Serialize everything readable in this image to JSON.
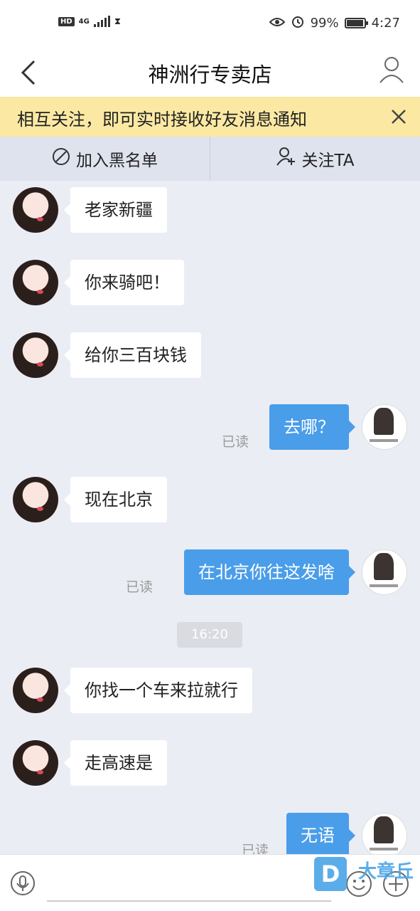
{
  "status_bar": {
    "hd": "HD",
    "network": "4G",
    "battery": "99%",
    "battery_level": 0.99,
    "time": "4:27"
  },
  "nav": {
    "title": "神洲行专卖店"
  },
  "banner": {
    "text": "相互关注，即可实时接收好友消息通知"
  },
  "actions": {
    "blacklist": "加入黑名单",
    "follow": "关注TA"
  },
  "messages": [
    {
      "side": "in",
      "text": "老家新疆"
    },
    {
      "side": "in",
      "text": "你来骑吧！"
    },
    {
      "side": "in",
      "text": "给你三百块钱"
    },
    {
      "side": "out",
      "text": "去哪？",
      "status": "已读"
    },
    {
      "side": "in",
      "text": "现在北京"
    },
    {
      "side": "out",
      "text": "在北京你往这发啥",
      "status": "已读"
    },
    {
      "side": "time",
      "text": "16:20"
    },
    {
      "side": "in",
      "text": "你找一个车来拉就行"
    },
    {
      "side": "in",
      "text": "走高速是"
    },
    {
      "side": "out",
      "text": "无语",
      "status": "已读"
    }
  ],
  "watermark": {
    "logo": "D",
    "text": "大章丘"
  },
  "colors": {
    "banner_bg": "#fbe9a3",
    "outgoing_bubble": "#4a9de9",
    "chat_bg": "#ebedf5"
  }
}
